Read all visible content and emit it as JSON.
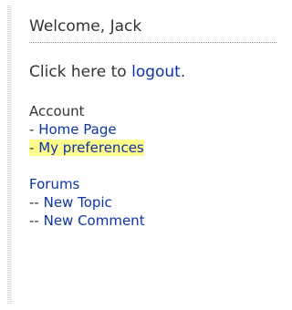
{
  "welcome": "Welcome, Jack",
  "logout": {
    "prefix": "Click here to ",
    "link": "logout",
    "suffix": "."
  },
  "account": {
    "heading": "Account",
    "items": [
      {
        "prefix": "- ",
        "label": "Home Page"
      },
      {
        "prefix": "- ",
        "label": "My preferences"
      }
    ]
  },
  "forums": {
    "heading": "Forums",
    "items": [
      {
        "prefix": "-- ",
        "label": "New Topic"
      },
      {
        "prefix": "-- ",
        "label": "New Comment"
      }
    ]
  },
  "colors": {
    "link": "#0b35a6",
    "text": "#333333",
    "highlight": "#fffa8c",
    "divider": "#9a9a9a"
  }
}
